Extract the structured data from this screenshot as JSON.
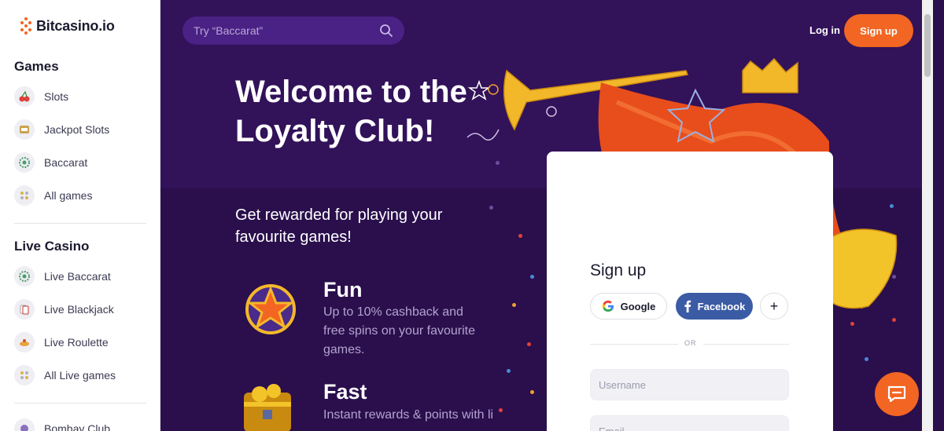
{
  "brand": {
    "name": "Bitcasino.io",
    "accent": "#f26522"
  },
  "sidebar": {
    "sections": [
      {
        "title": "Games"
      },
      {
        "title": "Live Casino"
      }
    ],
    "games": [
      {
        "label": "Slots",
        "icon": "cherry-icon"
      },
      {
        "label": "Jackpot Slots",
        "icon": "jackpot-icon"
      },
      {
        "label": "Baccarat",
        "icon": "baccarat-icon"
      },
      {
        "label": "All games",
        "icon": "grid-icon"
      }
    ],
    "live": [
      {
        "label": "Live Baccarat",
        "icon": "baccarat-icon"
      },
      {
        "label": "Live Blackjack",
        "icon": "cards-icon"
      },
      {
        "label": "Live Roulette",
        "icon": "roulette-icon"
      },
      {
        "label": "All Live games",
        "icon": "grid-icon"
      }
    ],
    "more": {
      "label": "Bombay Club"
    }
  },
  "header": {
    "search_placeholder": "Try “Baccarat”",
    "login_label": "Log in",
    "signup_label": "Sign up"
  },
  "hero": {
    "title": "Welcome to the Loyalty Club!",
    "subtitle": "Get rewarded for playing your favourite games!"
  },
  "features": [
    {
      "title": "Fun",
      "desc": "Up to 10% cashback and free spins on your favourite games.",
      "icon": "star-medal-icon"
    },
    {
      "title": "Fast",
      "desc": "Instant rewards & points with li",
      "icon": "treasure-chest-icon"
    }
  ],
  "signup_card": {
    "title": "Sign up",
    "google_label": "Google",
    "facebook_label": "Facebook",
    "more_label": "+",
    "or_label": "OR",
    "username_placeholder": "Username",
    "email_placeholder": "Email"
  }
}
